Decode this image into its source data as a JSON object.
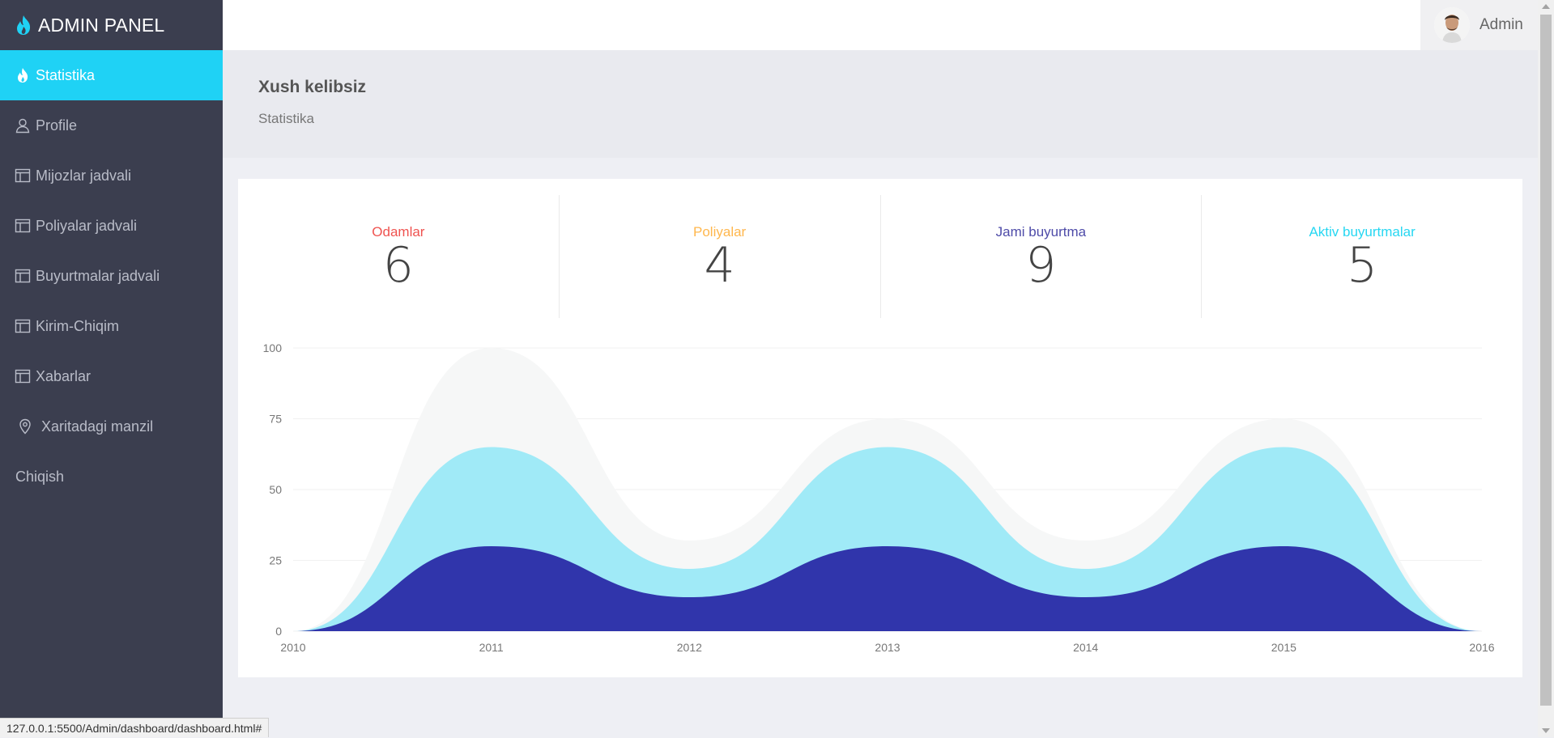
{
  "brand": {
    "title": "ADMIN PANEL"
  },
  "sidebar": {
    "items": [
      {
        "label": "Statistika",
        "icon": "flame-icon",
        "active": true
      },
      {
        "label": "Profile",
        "icon": "user-icon"
      },
      {
        "label": "Mijozlar jadvali",
        "icon": "table-icon"
      },
      {
        "label": "Poliyalar jadvali",
        "icon": "table-icon"
      },
      {
        "label": "Buyurtmalar jadvali",
        "icon": "table-icon"
      },
      {
        "label": "Kirim-Chiqim",
        "icon": "table-icon"
      },
      {
        "label": "Xabarlar",
        "icon": "table-icon"
      },
      {
        "label": "Xaritadagi manzil",
        "icon": "map-pin-icon"
      },
      {
        "label": "Chiqish",
        "icon": ""
      }
    ]
  },
  "topbar": {
    "user_name": "Admin"
  },
  "header": {
    "title": "Xush kelibsiz",
    "subtitle": "Statistika"
  },
  "stats": [
    {
      "label": "Odamlar",
      "value": "6",
      "color": "#ef5350"
    },
    {
      "label": "Poliyalar",
      "value": "4",
      "color": "#ffb74d"
    },
    {
      "label": "Jami buyurtma",
      "value": "9",
      "color": "#4e4ba8"
    },
    {
      "label": "Aktiv buyurtmalar",
      "value": "5",
      "color": "#26d7f2"
    }
  ],
  "colors": {
    "sidebar_bg": "#3b3e4f",
    "accent": "#1fd2f5",
    "series_1": "#f6f7f7",
    "series_2": "#a0eaf7",
    "series_3": "#3035ab"
  },
  "chart_data": {
    "type": "area",
    "x": [
      "2010",
      "2011",
      "2012",
      "2013",
      "2014",
      "2015",
      "2016"
    ],
    "series": [
      {
        "values": [
          0,
          100,
          32,
          75,
          32,
          75,
          0
        ]
      },
      {
        "values": [
          0,
          65,
          22,
          65,
          22,
          65,
          0
        ]
      },
      {
        "values": [
          0,
          30,
          12,
          30,
          12,
          30,
          0
        ]
      }
    ],
    "ylim": [
      0,
      100
    ],
    "yticks": [
      "0",
      "25",
      "50",
      "75",
      "100"
    ],
    "grid": true,
    "smooth": true,
    "stacked": false
  },
  "status_url": "127.0.0.1:5500/Admin/dashboard/dashboard.html#"
}
